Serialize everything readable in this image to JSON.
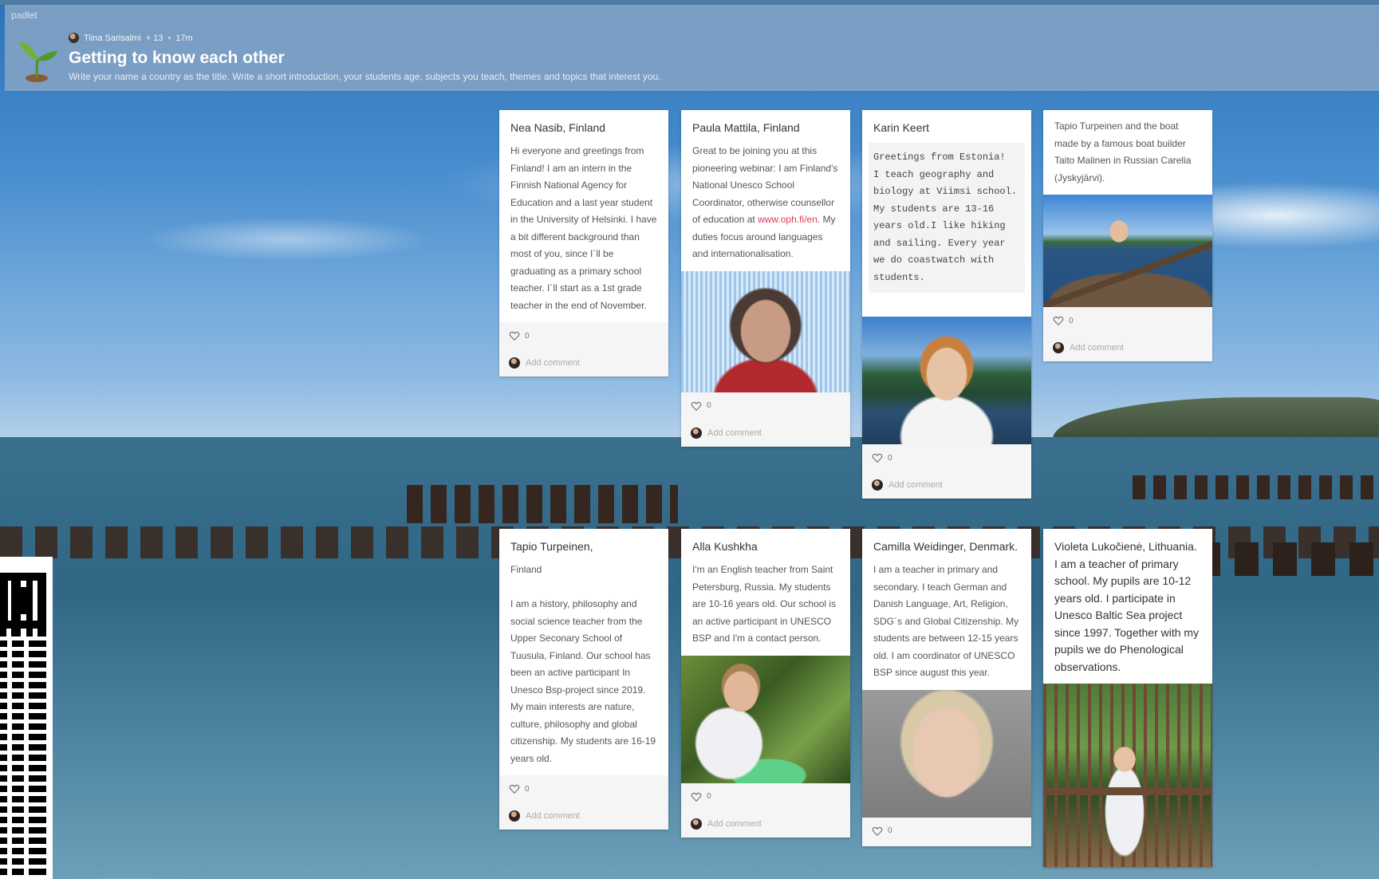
{
  "header": {
    "brand": "padlet",
    "author": "Tiina Sarisalmi",
    "contributors": "+ 13",
    "separator": "•",
    "time": "17m",
    "title": "Getting to know each other",
    "subtitle": "Write your name a country as the title. Write a short introduction, your students age, subjects you teach, themes and topics that interest you."
  },
  "ui": {
    "add_comment": "Add comment",
    "heart_icon": "heart-outline-icon",
    "accent_color": "#e0385c"
  },
  "cards": [
    {
      "title": "Nea Nasib, Finland",
      "body": "Hi everyone and greetings from Finland! I am an intern in the Finnish National Agency for Education and a last year student in the University of Helsinki. I have a bit different background than most of you, since I´ll be graduating as a primary school teacher. I´ll start as a 1st grade teacher in the end of November.",
      "likes": "0"
    },
    {
      "title": "Paula Mattila, Finland",
      "body_before": "Great to be joining you at this pioneering webinar: I am Finland's National Unesco School Coordinator, otherwise counsellor of education at ",
      "link": "www.oph.fi/en",
      "body_after": ". My duties focus around languages and internationalisation.",
      "likes": "0"
    },
    {
      "title": "Karin Keert",
      "body": "Greetings from Estonia!\nI teach geography and biology at Viimsi school. My students are 13-16 years old.I like hiking and sailing. Every year we do coastwatch with students.",
      "likes": "0"
    },
    {
      "title": "Tapio Turpeinen and the boat made by a famous boat builder Taito Malinen in Russian Carelia (Jyskyjärvi).",
      "likes": "0"
    },
    {
      "title": "Tapio Turpeinen,",
      "body_country": "Finland",
      "body": "I am a history, philosophy and social science teacher from the Upper Seconary School of Tuusula, Finland. Our school has been an active participant In Unesco Bsp-project since 2019. My main interests are nature, culture, philosophy and global citizenship. My students are 16-19 years old.",
      "likes": "0"
    },
    {
      "title": "Alla Kushkha",
      "body": "I'm an English teacher from Saint Petersburg, Russia. My students are 10-16 years old. Our school is an active participant in UNESCO BSP and I'm a contact person.",
      "likes": "0"
    },
    {
      "title": "Camilla Weidinger, Denmark.",
      "body": "I am a teacher in primary and secondary. I teach German and Danish Language, Art, Religion, SDG´s and Global Citizenship. My students are between 12-15 years old. I am coordinator of UNESCO BSP since august this year.",
      "likes": "0"
    },
    {
      "title": "Violeta Lukočienė, Lithuania. I am a teacher of primary school. My pupils are 10-12 years old. I participate in Unesco Baltic Sea project since 1997. Together with my pupils we do Phenological observations."
    }
  ]
}
